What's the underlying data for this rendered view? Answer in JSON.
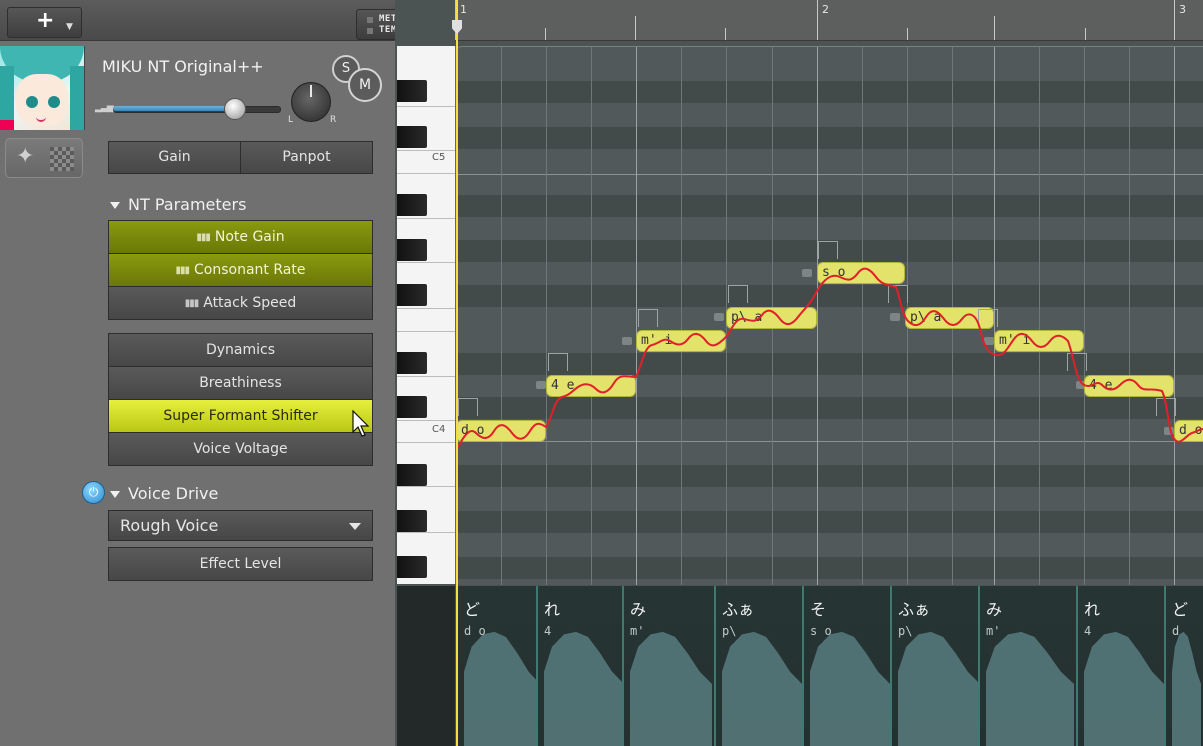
{
  "toolbar": {
    "add_label": "+",
    "meter_label": "METER",
    "tempo_label": "TEMPO",
    "collapse_label": "«"
  },
  "track": {
    "singer_name": "MIKU NT Original++",
    "volume_fraction": 0.73,
    "solo_label": "S",
    "mute_label": "M",
    "pan_l": "L",
    "pan_r": "R"
  },
  "mix_buttons": {
    "gain": "Gain",
    "panpot": "Panpot"
  },
  "nt_parameters": {
    "header": "NT Parameters",
    "items": [
      {
        "label": "Note Gain",
        "state": "active"
      },
      {
        "label": "Consonant Rate",
        "state": "active"
      },
      {
        "label": "Attack Speed",
        "state": "normal"
      }
    ]
  },
  "params": {
    "items": [
      {
        "label": "Dynamics",
        "state": "normal"
      },
      {
        "label": "Breathiness",
        "state": "normal"
      },
      {
        "label": "Super Formant Shifter",
        "state": "selected"
      },
      {
        "label": "Voice Voltage",
        "state": "normal"
      }
    ]
  },
  "voice_drive": {
    "header": "Voice Drive",
    "enabled": true,
    "selected_preset": "Rough Voice",
    "effect_button": "Effect Level"
  },
  "ruler": {
    "bars": [
      "1",
      "2",
      "3"
    ]
  },
  "piano": {
    "labels": [
      "C5",
      "C4"
    ]
  },
  "notes": [
    {
      "phonemes": "d o",
      "pitch": "C4"
    },
    {
      "phonemes": "4 e",
      "pitch": "D4"
    },
    {
      "phonemes": "m' i",
      "pitch": "E4"
    },
    {
      "phonemes": "p\\ a",
      "pitch": "F4"
    },
    {
      "phonemes": "s o",
      "pitch": "G4"
    },
    {
      "phonemes": "p\\ a",
      "pitch": "F4"
    },
    {
      "phonemes": "m' i",
      "pitch": "E4"
    },
    {
      "phonemes": "4 e",
      "pitch": "D4"
    },
    {
      "phonemes": "d o",
      "pitch": "C4"
    }
  ],
  "lyrics": [
    {
      "kana": "ど",
      "phonemes": "d o"
    },
    {
      "kana": "れ",
      "phonemes": "4"
    },
    {
      "kana": "み",
      "phonemes": "m'"
    },
    {
      "kana": "ふぁ",
      "phonemes": "p\\"
    },
    {
      "kana": "そ",
      "phonemes": "s o"
    },
    {
      "kana": "ふぁ",
      "phonemes": "p\\"
    },
    {
      "kana": "み",
      "phonemes": "m'"
    },
    {
      "kana": "れ",
      "phonemes": "4"
    },
    {
      "kana": "ど",
      "phonemes": "d"
    }
  ],
  "colors": {
    "note_fill": "#e3e26a",
    "pitch_curve": "#e0202a",
    "highlight": "#d8e62a",
    "playhead": "#f0e040"
  }
}
